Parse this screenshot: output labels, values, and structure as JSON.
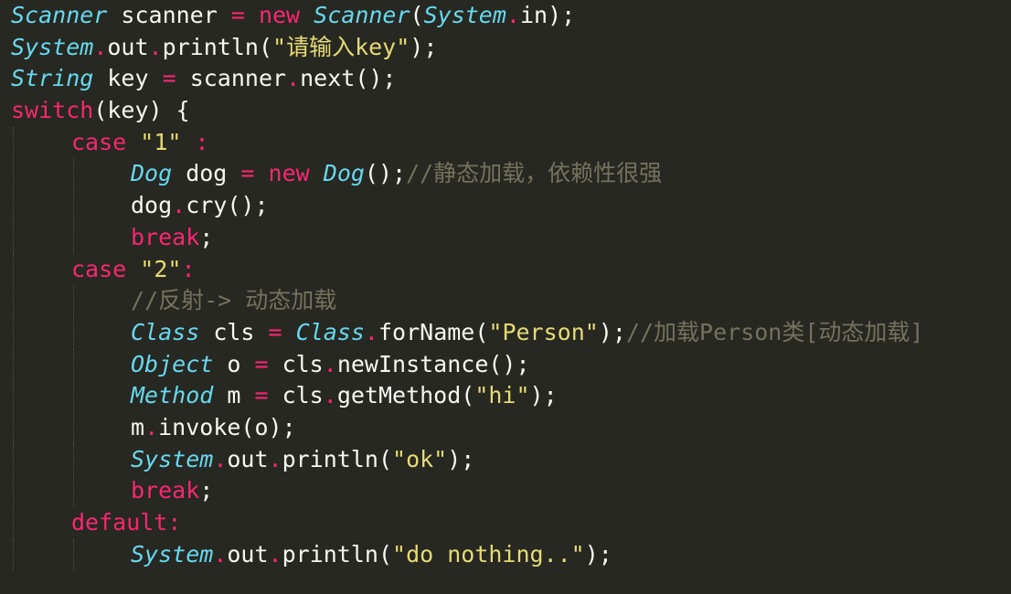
{
  "lines": [
    {
      "indent": 0,
      "tokens": [
        {
          "c": "type",
          "t": "Scanner"
        },
        {
          "c": "plain",
          "t": " scanner "
        },
        {
          "c": "op",
          "t": "="
        },
        {
          "c": "plain",
          "t": " "
        },
        {
          "c": "kw",
          "t": "new"
        },
        {
          "c": "plain",
          "t": " "
        },
        {
          "c": "type",
          "t": "Scanner"
        },
        {
          "c": "plain",
          "t": "("
        },
        {
          "c": "type",
          "t": "System"
        },
        {
          "c": "op",
          "t": "."
        },
        {
          "c": "plain",
          "t": "in);"
        }
      ]
    },
    {
      "indent": 0,
      "tokens": [
        {
          "c": "type",
          "t": "System"
        },
        {
          "c": "op",
          "t": "."
        },
        {
          "c": "plain",
          "t": "out"
        },
        {
          "c": "op",
          "t": "."
        },
        {
          "c": "plain",
          "t": "println("
        },
        {
          "c": "str",
          "t": "\"请输入key\""
        },
        {
          "c": "plain",
          "t": ");"
        }
      ]
    },
    {
      "indent": 0,
      "tokens": [
        {
          "c": "type",
          "t": "String"
        },
        {
          "c": "plain",
          "t": " key "
        },
        {
          "c": "op",
          "t": "="
        },
        {
          "c": "plain",
          "t": " scanner"
        },
        {
          "c": "op",
          "t": "."
        },
        {
          "c": "plain",
          "t": "next();"
        }
      ]
    },
    {
      "indent": 0,
      "tokens": [
        {
          "c": "kw",
          "t": "switch"
        },
        {
          "c": "plain",
          "t": "(key) "
        },
        {
          "c": "plain",
          "t": "{"
        }
      ]
    },
    {
      "indent": 1,
      "tokens": [
        {
          "c": "kw",
          "t": "case"
        },
        {
          "c": "plain",
          "t": " "
        },
        {
          "c": "str",
          "t": "\"1\""
        },
        {
          "c": "plain",
          "t": " "
        },
        {
          "c": "kw",
          "t": ":"
        }
      ]
    },
    {
      "indent": 2,
      "tokens": [
        {
          "c": "type",
          "t": "Dog"
        },
        {
          "c": "plain",
          "t": " dog "
        },
        {
          "c": "op",
          "t": "="
        },
        {
          "c": "plain",
          "t": " "
        },
        {
          "c": "kw",
          "t": "new"
        },
        {
          "c": "plain",
          "t": " "
        },
        {
          "c": "type",
          "t": "Dog"
        },
        {
          "c": "plain",
          "t": "();"
        },
        {
          "c": "cmt",
          "t": "//静态加载，依赖性很强"
        }
      ]
    },
    {
      "indent": 2,
      "tokens": [
        {
          "c": "plain",
          "t": "dog"
        },
        {
          "c": "op",
          "t": "."
        },
        {
          "c": "plain",
          "t": "cry();"
        }
      ]
    },
    {
      "indent": 2,
      "tokens": [
        {
          "c": "kw",
          "t": "break"
        },
        {
          "c": "plain",
          "t": ";"
        }
      ]
    },
    {
      "indent": 1,
      "tokens": [
        {
          "c": "kw",
          "t": "case"
        },
        {
          "c": "plain",
          "t": " "
        },
        {
          "c": "str",
          "t": "\"2\""
        },
        {
          "c": "kw",
          "t": ":"
        }
      ]
    },
    {
      "indent": 2,
      "tokens": [
        {
          "c": "cmt",
          "t": "//反射-> 动态加载"
        }
      ]
    },
    {
      "indent": 2,
      "tokens": [
        {
          "c": "type",
          "t": "Class"
        },
        {
          "c": "plain",
          "t": " cls "
        },
        {
          "c": "op",
          "t": "="
        },
        {
          "c": "plain",
          "t": " "
        },
        {
          "c": "type",
          "t": "Class"
        },
        {
          "c": "op",
          "t": "."
        },
        {
          "c": "plain",
          "t": "forName("
        },
        {
          "c": "str",
          "t": "\"Person\""
        },
        {
          "c": "plain",
          "t": ");"
        },
        {
          "c": "cmt",
          "t": "//加载Person类[动态加载]"
        }
      ]
    },
    {
      "indent": 2,
      "tokens": [
        {
          "c": "type",
          "t": "Object"
        },
        {
          "c": "plain",
          "t": " o "
        },
        {
          "c": "op",
          "t": "="
        },
        {
          "c": "plain",
          "t": " cls"
        },
        {
          "c": "op",
          "t": "."
        },
        {
          "c": "plain",
          "t": "newInstance();"
        }
      ]
    },
    {
      "indent": 2,
      "tokens": [
        {
          "c": "type",
          "t": "Method"
        },
        {
          "c": "plain",
          "t": " m "
        },
        {
          "c": "op",
          "t": "="
        },
        {
          "c": "plain",
          "t": " cls"
        },
        {
          "c": "op",
          "t": "."
        },
        {
          "c": "plain",
          "t": "getMethod("
        },
        {
          "c": "str",
          "t": "\"hi\""
        },
        {
          "c": "plain",
          "t": ");"
        }
      ]
    },
    {
      "indent": 2,
      "tokens": [
        {
          "c": "plain",
          "t": "m"
        },
        {
          "c": "op",
          "t": "."
        },
        {
          "c": "plain",
          "t": "invoke(o);"
        }
      ]
    },
    {
      "indent": 2,
      "tokens": [
        {
          "c": "type",
          "t": "System"
        },
        {
          "c": "op",
          "t": "."
        },
        {
          "c": "plain",
          "t": "out"
        },
        {
          "c": "op",
          "t": "."
        },
        {
          "c": "plain",
          "t": "println("
        },
        {
          "c": "str",
          "t": "\"ok\""
        },
        {
          "c": "plain",
          "t": ");"
        }
      ]
    },
    {
      "indent": 2,
      "tokens": [
        {
          "c": "kw",
          "t": "break"
        },
        {
          "c": "plain",
          "t": ";"
        }
      ]
    },
    {
      "indent": 1,
      "tokens": [
        {
          "c": "kw",
          "t": "default"
        },
        {
          "c": "kw",
          "t": ":"
        }
      ]
    },
    {
      "indent": 2,
      "tokens": [
        {
          "c": "type",
          "t": "System"
        },
        {
          "c": "op",
          "t": "."
        },
        {
          "c": "plain",
          "t": "out"
        },
        {
          "c": "op",
          "t": "."
        },
        {
          "c": "plain",
          "t": "println("
        },
        {
          "c": "str",
          "t": "\"do nothing..\""
        },
        {
          "c": "plain",
          "t": ");"
        }
      ]
    }
  ]
}
